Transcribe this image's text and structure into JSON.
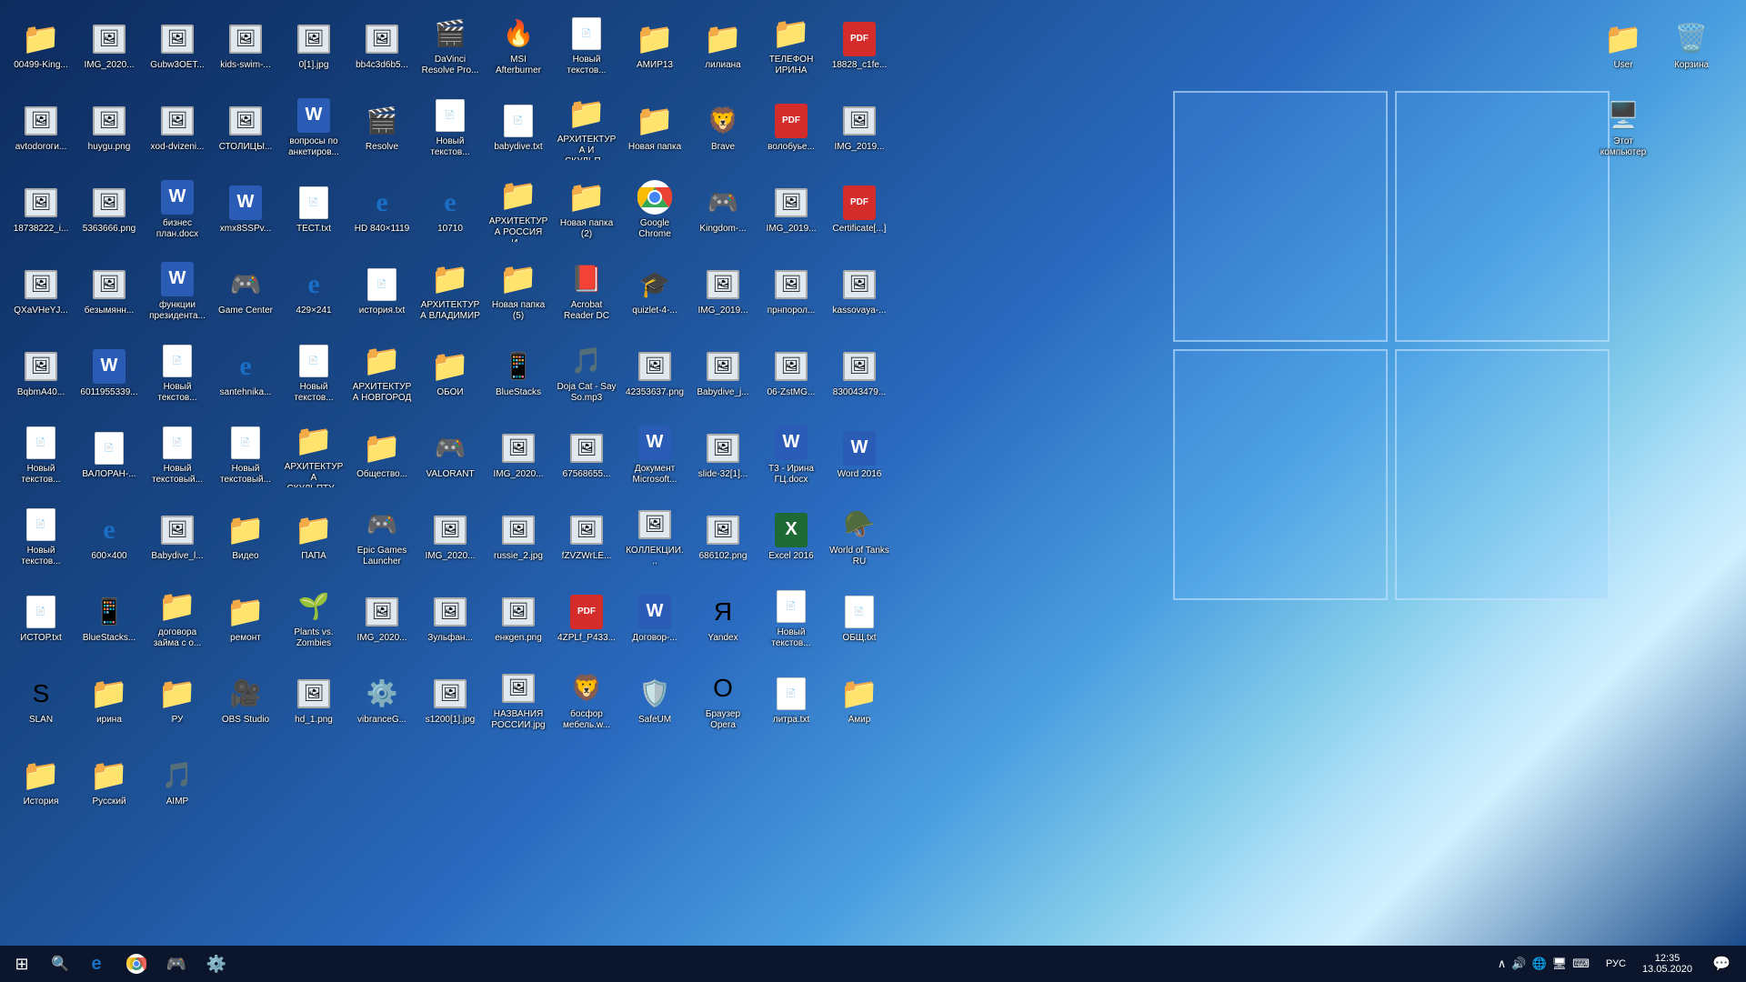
{
  "desktop": {
    "icons_row1": [
      {
        "id": "00499-king",
        "label": "00499-King...",
        "type": "folder",
        "emoji": "📁"
      },
      {
        "id": "img-2020-1",
        "label": "IMG_2020...",
        "type": "image",
        "emoji": "🖼️"
      },
      {
        "id": "gubw3oet",
        "label": "Gubw3OET...",
        "type": "image",
        "emoji": "🖼️"
      },
      {
        "id": "kids-swim",
        "label": "kids-swim-...",
        "type": "image",
        "emoji": "🖼️"
      },
      {
        "id": "0-1-jpg",
        "label": "0[1].jpg",
        "type": "image",
        "emoji": "🖼️"
      },
      {
        "id": "bb4c3d6b5",
        "label": "bb4c3d6b5...",
        "type": "image",
        "emoji": "🖼️"
      },
      {
        "id": "davinci",
        "label": "DaVinci Resolve Pro...",
        "type": "app",
        "emoji": "🎬"
      },
      {
        "id": "msi-afterburner",
        "label": "MSI Afterburner",
        "type": "app",
        "emoji": "🔥"
      },
      {
        "id": "novyi-text-1",
        "label": "Новый текстов...",
        "type": "txt",
        "emoji": "📄"
      },
      {
        "id": "amir13",
        "label": "АМИР13",
        "type": "folder",
        "emoji": "📁"
      },
      {
        "id": "liliana",
        "label": "лилиана",
        "type": "folder",
        "emoji": "📁"
      },
      {
        "id": "telefon-irina",
        "label": "ТЕЛЕФОН ИРИНА",
        "type": "folder",
        "emoji": "📁"
      }
    ],
    "icons_row2": [
      {
        "id": "18828-c1fe",
        "label": "18828_c1fe...",
        "type": "pdf",
        "emoji": "PDF"
      },
      {
        "id": "avtodorog",
        "label": "avtodoroги...",
        "type": "image",
        "emoji": "🖼️"
      },
      {
        "id": "huygu-png",
        "label": "huygu.png",
        "type": "image",
        "emoji": "🖼️"
      },
      {
        "id": "xod-dvizeni",
        "label": "xod-dvizeni...",
        "type": "image",
        "emoji": "🖼️"
      },
      {
        "id": "stolitcy",
        "label": "СТОЛИЦЫ...",
        "type": "image",
        "emoji": "🖼️"
      },
      {
        "id": "voprosy-po",
        "label": "вопросы по анкетиров...",
        "type": "word",
        "emoji": "W"
      },
      {
        "id": "resolve",
        "label": "Resolve",
        "type": "app",
        "emoji": "🎬"
      },
      {
        "id": "novyi-text-2",
        "label": "Новый текстов...",
        "type": "txt",
        "emoji": "📄"
      },
      {
        "id": "babydive-txt",
        "label": "babydive.txt",
        "type": "txt",
        "emoji": "📄"
      },
      {
        "id": "arhitektura-skulp",
        "label": "АРХИТЕКТУРА И СКУЛЬП...",
        "type": "folder",
        "emoji": "📁"
      },
      {
        "id": "novaya-papka",
        "label": "Новая папка",
        "type": "folder",
        "emoji": "📁"
      },
      {
        "id": "brave",
        "label": "Brave",
        "type": "app",
        "emoji": "🦁"
      }
    ],
    "icons_row3": [
      {
        "id": "volobuye",
        "label": "волобуье...",
        "type": "pdf",
        "emoji": "PDF"
      },
      {
        "id": "img-2019-1",
        "label": "IMG_2019...",
        "type": "image",
        "emoji": "🖼️"
      },
      {
        "id": "18738222",
        "label": "18738222_i...",
        "type": "image",
        "emoji": "🖼️"
      },
      {
        "id": "5363666-png",
        "label": "5363666.png",
        "type": "image",
        "emoji": "🖼️"
      },
      {
        "id": "biznes-plan",
        "label": "бизнес план.docx",
        "type": "word",
        "emoji": "W"
      },
      {
        "id": "xmx8sspv",
        "label": "xmx8SSPv...",
        "type": "word",
        "emoji": "W"
      },
      {
        "id": "test-txt",
        "label": "ТЕСТ.txt",
        "type": "txt",
        "emoji": "📄"
      },
      {
        "id": "hd-840",
        "label": "HD 840×1119",
        "type": "ie",
        "emoji": "e"
      },
      {
        "id": "10710",
        "label": "10710",
        "type": "ie",
        "emoji": "e"
      },
      {
        "id": "arhitektura-rossiya",
        "label": "АРХИТЕКТУРА РОССИЯ И...",
        "type": "folder",
        "emoji": "📁"
      },
      {
        "id": "novaya-papka-2",
        "label": "Новая папка (2)",
        "type": "folder",
        "emoji": "📁"
      },
      {
        "id": "google-chrome",
        "label": "Google Chrome",
        "type": "chrome",
        "emoji": "🌐"
      }
    ],
    "icons_row4": [
      {
        "id": "kingdom",
        "label": "Kingdom-...",
        "type": "app",
        "emoji": "🎮"
      },
      {
        "id": "img-2019-2",
        "label": "IMG_2019...",
        "type": "image",
        "emoji": "🖼️"
      },
      {
        "id": "certificate",
        "label": "Certificate[...]",
        "type": "pdf",
        "emoji": "PDF"
      },
      {
        "id": "qxavheyv",
        "label": "QXaVHeYJ...",
        "type": "image",
        "emoji": "🖼️"
      },
      {
        "id": "bezymyanny",
        "label": "безымянн...",
        "type": "image",
        "emoji": "🖼️"
      },
      {
        "id": "funktsii-prez",
        "label": "функции президента...",
        "type": "word",
        "emoji": "W"
      },
      {
        "id": "game-center",
        "label": "Game Center",
        "type": "app",
        "emoji": "🎮"
      },
      {
        "id": "429x241",
        "label": "429×241",
        "type": "ie",
        "emoji": "e"
      },
      {
        "id": "istoriya-txt",
        "label": "история.txt",
        "type": "txt",
        "emoji": "📄"
      },
      {
        "id": "arhitektura-vladimir",
        "label": "АРХИТЕКТУРА ВЛАДИМИР",
        "type": "folder",
        "emoji": "📁"
      },
      {
        "id": "novaya-papka-5",
        "label": "Новая папка (5)",
        "type": "folder",
        "emoji": "📁"
      },
      {
        "id": "acrobat-dc",
        "label": "Acrobat Reader DC",
        "type": "app",
        "emoji": "📕"
      }
    ],
    "icons_row5": [
      {
        "id": "quizlet-4",
        "label": "quizlet-4-...",
        "type": "app",
        "emoji": "🎓"
      },
      {
        "id": "img-2019-3",
        "label": "IMG_2019...",
        "type": "image",
        "emoji": "🖼️"
      },
      {
        "id": "prn",
        "label": "прнпорол...",
        "type": "image",
        "emoji": "🖼️"
      },
      {
        "id": "kassovaya",
        "label": "kassovaya-...",
        "type": "image",
        "emoji": "🖼️"
      },
      {
        "id": "bqbma440",
        "label": "BqbmA40...",
        "type": "image",
        "emoji": "🖼️"
      },
      {
        "id": "6011955339",
        "label": "6011955339...",
        "type": "word",
        "emoji": "W"
      },
      {
        "id": "novyi-text-3",
        "label": "Новый текстов...",
        "type": "txt",
        "emoji": "📄"
      },
      {
        "id": "santehnika",
        "label": "santehnika...",
        "type": "ie",
        "emoji": "e"
      },
      {
        "id": "novyi-text-4",
        "label": "Новый текстов...",
        "type": "txt",
        "emoji": "📄"
      },
      {
        "id": "arhitektura-novgorod",
        "label": "АРХИТЕКТУРА НОВГОРОД",
        "type": "folder",
        "emoji": "📁"
      },
      {
        "id": "oboi",
        "label": "ОБОИ",
        "type": "folder",
        "emoji": "📁"
      },
      {
        "id": "bluestacks",
        "label": "BlueStacks",
        "type": "app",
        "emoji": "📱"
      }
    ],
    "icons_row6": [
      {
        "id": "doja-cat",
        "label": "Doja Cat - Say So.mp3",
        "type": "music",
        "emoji": "🎵"
      },
      {
        "id": "42353637",
        "label": "42353637.png",
        "type": "image",
        "emoji": "🖼️"
      },
      {
        "id": "babydive-jpg",
        "label": "Babydive_j...",
        "type": "image",
        "emoji": "🖼️"
      },
      {
        "id": "06-zstmg",
        "label": "06-ZstMG...",
        "type": "image",
        "emoji": "🖼️"
      },
      {
        "id": "830043479",
        "label": "830043479...",
        "type": "image",
        "emoji": "🖼️"
      },
      {
        "id": "novyi-text-5",
        "label": "Новый текстов...",
        "type": "txt",
        "emoji": "📄"
      },
      {
        "id": "valorant-txt",
        "label": "ВАЛОРАН-...",
        "type": "txt",
        "emoji": "📄"
      },
      {
        "id": "novyi-text-6",
        "label": "Новый текстовый...",
        "type": "txt",
        "emoji": "📄"
      },
      {
        "id": "novyi-text-7",
        "label": "Новый текстовый...",
        "type": "txt",
        "emoji": "📄"
      },
      {
        "id": "arhitektura-skulpt2",
        "label": "АРХИТЕКТУРА СКУЛЬПТУ...",
        "type": "folder",
        "emoji": "📁"
      },
      {
        "id": "obschee",
        "label": "Общество...",
        "type": "folder",
        "emoji": "📁"
      },
      {
        "id": "valorant",
        "label": "VALORANT",
        "type": "app",
        "emoji": "🎮"
      }
    ],
    "icons_row7": [
      {
        "id": "img-2020-2",
        "label": "IMG_2020...",
        "type": "image",
        "emoji": "🖼️"
      },
      {
        "id": "67568655",
        "label": "67568655...",
        "type": "image",
        "emoji": "🖼️"
      },
      {
        "id": "dokument-ms",
        "label": "Документ Microsoft...",
        "type": "word",
        "emoji": "W"
      },
      {
        "id": "slide-32",
        "label": "slide-32[1]...",
        "type": "image",
        "emoji": "🖼️"
      },
      {
        "id": "t3-irina",
        "label": "Т3 - Ирина ГЦ.docx",
        "type": "word",
        "emoji": "W"
      },
      {
        "id": "word-2016",
        "label": "Word 2016",
        "type": "word-app",
        "emoji": "W"
      },
      {
        "id": "novyi-text-8",
        "label": "Новый текстов...",
        "type": "txt",
        "emoji": "📄"
      },
      {
        "id": "600x400",
        "label": "600×400",
        "type": "ie",
        "emoji": "e"
      },
      {
        "id": "babydive-jpg2",
        "label": "Babydive_l...",
        "type": "image",
        "emoji": "🖼️"
      },
      {
        "id": "video",
        "label": "Видео",
        "type": "folder",
        "emoji": "📁"
      },
      {
        "id": "papa",
        "label": "ПАПА",
        "type": "folder",
        "emoji": "📁"
      },
      {
        "id": "epic-games",
        "label": "Epic Games Launcher",
        "type": "app",
        "emoji": "🎮"
      }
    ],
    "icons_row8": [
      {
        "id": "img-2020-3",
        "label": "IMG_2020...",
        "type": "image",
        "emoji": "🖼️"
      },
      {
        "id": "russie-2",
        "label": "russie_2.jpg",
        "type": "image",
        "emoji": "🖼️"
      },
      {
        "id": "fzvzwrle",
        "label": "fZVZWrLE...",
        "type": "image",
        "emoji": "🖼️"
      },
      {
        "id": "kollektsii",
        "label": "КОЛЛЕКЦИИ...",
        "type": "image",
        "emoji": "🖼️"
      },
      {
        "id": "686102-png",
        "label": "686102.png",
        "type": "image",
        "emoji": "🖼️"
      },
      {
        "id": "excel-2016",
        "label": "Excel 2016",
        "type": "excel-app",
        "emoji": "X"
      },
      {
        "id": "world-of-tanks",
        "label": "World of Tanks RU",
        "type": "app",
        "emoji": "🪖"
      },
      {
        "id": "istor-txt",
        "label": "ИСТОР.txt",
        "type": "txt",
        "emoji": "📄"
      },
      {
        "id": "bluestacks-2",
        "label": "BlueStacks...",
        "type": "app",
        "emoji": "📱"
      },
      {
        "id": "dogovor-zaim",
        "label": "договора займа с о...",
        "type": "folder",
        "emoji": "📁"
      },
      {
        "id": "remont",
        "label": "ремонт",
        "type": "folder",
        "emoji": "📁"
      },
      {
        "id": "plants-zombies",
        "label": "Plants vs. Zombies",
        "type": "app",
        "emoji": "🌱"
      }
    ],
    "icons_row9": [
      {
        "id": "img-2020-4",
        "label": "IMG_2020...",
        "type": "image",
        "emoji": "🖼️"
      },
      {
        "id": "zulfan",
        "label": "Зульфан...",
        "type": "image",
        "emoji": "🖼️"
      },
      {
        "id": "enkgen-png",
        "label": "енкgen.png",
        "type": "image",
        "emoji": "🖼️"
      },
      {
        "id": "4zplf-p433",
        "label": "4ZPLf_P433...",
        "type": "pdf",
        "emoji": "PDF"
      },
      {
        "id": "dogovor-rossiya",
        "label": "Договор-...",
        "type": "word",
        "emoji": "W"
      },
      {
        "id": "yandex",
        "label": "Yandex",
        "type": "app",
        "emoji": "Я"
      },
      {
        "id": "novyi-text-9",
        "label": "Новый текстов...",
        "type": "txt",
        "emoji": "📄"
      },
      {
        "id": "obshch-txt",
        "label": "ОБЩ.txt",
        "type": "txt",
        "emoji": "📄"
      },
      {
        "id": "slan",
        "label": "SLAN",
        "type": "app",
        "emoji": "S"
      },
      {
        "id": "irina",
        "label": "ирина",
        "type": "folder",
        "emoji": "📁"
      },
      {
        "id": "ru",
        "label": "РУ",
        "type": "folder",
        "emoji": "📁"
      },
      {
        "id": "obs-studio",
        "label": "OBS Studio",
        "type": "app",
        "emoji": "🎥"
      }
    ],
    "icons_row10": [
      {
        "id": "hd-1-png",
        "label": "hd_1.png",
        "type": "image",
        "emoji": "🖼️"
      },
      {
        "id": "vibranceg",
        "label": "vibranceG...",
        "type": "app",
        "emoji": "⚙️"
      },
      {
        "id": "s1200-1",
        "label": "s1200[1].jpg",
        "type": "image",
        "emoji": "🖼️"
      },
      {
        "id": "nazvaniya-rossii",
        "label": "НАЗВАНИЯ РОССИИ.jpg",
        "type": "image",
        "emoji": "🖼️"
      },
      {
        "id": "bossfor",
        "label": "босфор мебель.w...",
        "type": "app",
        "emoji": "🦁"
      },
      {
        "id": "safeUM",
        "label": "SafeUM",
        "type": "app",
        "emoji": "🛡️"
      },
      {
        "id": "opera",
        "label": "Браузер Opera",
        "type": "app",
        "emoji": "O"
      },
      {
        "id": "litra-txt",
        "label": "литра.txt",
        "type": "txt",
        "emoji": "📄"
      },
      {
        "id": "amir-folder",
        "label": "Амир",
        "type": "folder",
        "emoji": "📁"
      },
      {
        "id": "istoriya-folder",
        "label": "История",
        "type": "folder",
        "emoji": "📁"
      },
      {
        "id": "russkiy",
        "label": "Русский",
        "type": "folder",
        "emoji": "📁"
      },
      {
        "id": "aimp",
        "label": "AIMP",
        "type": "app",
        "emoji": "🎵"
      }
    ],
    "icons_right": [
      {
        "id": "user",
        "label": "User",
        "type": "folder",
        "emoji": "👤"
      },
      {
        "id": "korzina",
        "label": "Корзина",
        "type": "recycle",
        "emoji": "🗑️"
      },
      {
        "id": "etot-komputer",
        "label": "Этот компьютер",
        "type": "computer",
        "emoji": "🖥️"
      }
    ]
  },
  "taskbar": {
    "start_label": "⊞",
    "search_icon": "🔍",
    "items": [
      {
        "id": "tb-explorer",
        "emoji": "e",
        "label": "Internet Explorer"
      },
      {
        "id": "tb-chrome",
        "emoji": "🌐",
        "label": "Google Chrome"
      },
      {
        "id": "tb-steam",
        "emoji": "🎮",
        "label": "Steam"
      },
      {
        "id": "tb-settings",
        "emoji": "⚙️",
        "label": "Settings"
      }
    ],
    "tray": {
      "icons": [
        "^",
        "🔊",
        "🌐",
        "🖥️",
        "⌨️"
      ],
      "language": "РУС",
      "time": "12:35",
      "date": "13.05.2020",
      "notification": "💬"
    }
  }
}
